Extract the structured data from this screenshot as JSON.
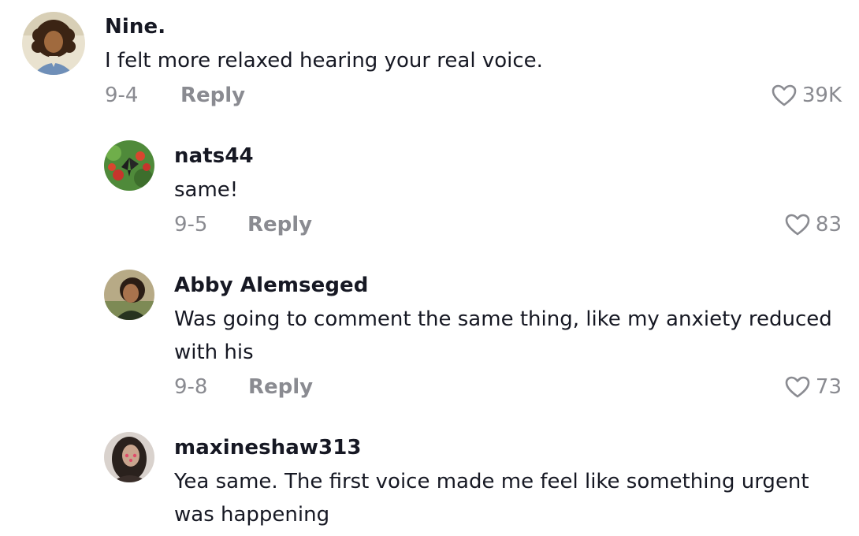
{
  "colors": {
    "text_primary": "#161823",
    "text_secondary": "#8a8b91",
    "background": "#ffffff"
  },
  "comments": [
    {
      "username": "Nine.",
      "text": "I felt more relaxed hearing your real voice.",
      "date": "9-4",
      "reply_label": "Reply",
      "likes": "39K",
      "avatar_icon": "avatar-illustrated-person"
    },
    {
      "username": "nats44",
      "text": "same!",
      "date": "9-5",
      "reply_label": "Reply",
      "likes": "83",
      "avatar_icon": "avatar-butterfly-photo"
    },
    {
      "username": "Abby Alemseged",
      "text": "Was going to comment the same thing, like my anxiety reduced with his",
      "date": "9-8",
      "reply_label": "Reply",
      "likes": "73",
      "avatar_icon": "avatar-person-photo"
    },
    {
      "username": "maxineshaw313",
      "text": "Yea same. The first voice made me feel like something urgent was happening",
      "avatar_icon": "avatar-person-photo"
    }
  ]
}
